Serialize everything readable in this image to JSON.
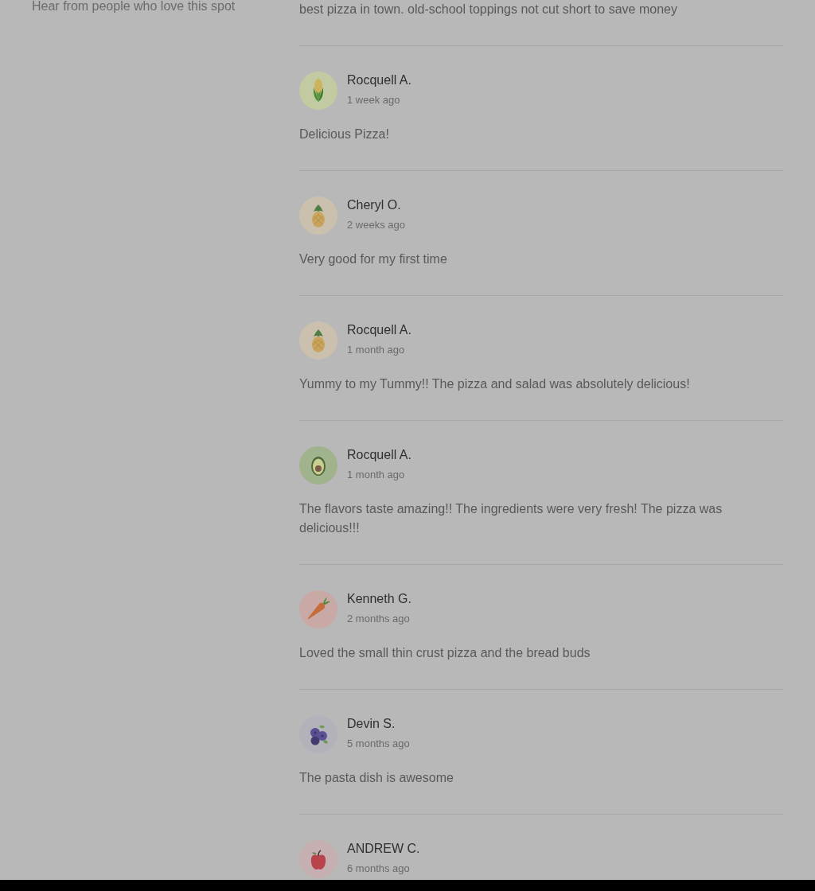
{
  "intro": {
    "tagline": "Hear from people who love this spot"
  },
  "reviews": [
    {
      "body": "best pizza in town. old-school toppings not cut short to save money"
    },
    {
      "kind": "corn",
      "name": "Rocquell A.",
      "time": "1 week ago",
      "body": "Delicious Pizza!"
    },
    {
      "kind": "pineapple",
      "name": "Cheryl O.",
      "time": "2 weeks ago",
      "body": "Very good for my first time"
    },
    {
      "kind": "pineapple",
      "name": "Rocquell A.",
      "time": "1 month ago",
      "body": "Yummy to my Tummy!! The pizza and salad was absolutely delicious!"
    },
    {
      "kind": "avocado",
      "name": "Rocquell A.",
      "time": "1 month ago",
      "body": "The flavors taste amazing!! The ingredients were very fresh! The pizza was delicious!!!"
    },
    {
      "kind": "carrot",
      "name": "Kenneth G.",
      "time": "2 months ago",
      "body": "Loved the small thin crust pizza and the bread buds"
    },
    {
      "kind": "blueberries",
      "name": "Devin S.",
      "time": "5 months ago",
      "body": "The pasta dish is awesome"
    },
    {
      "kind": "apple",
      "name": "ANDREW C.",
      "time": "6 months ago"
    }
  ]
}
